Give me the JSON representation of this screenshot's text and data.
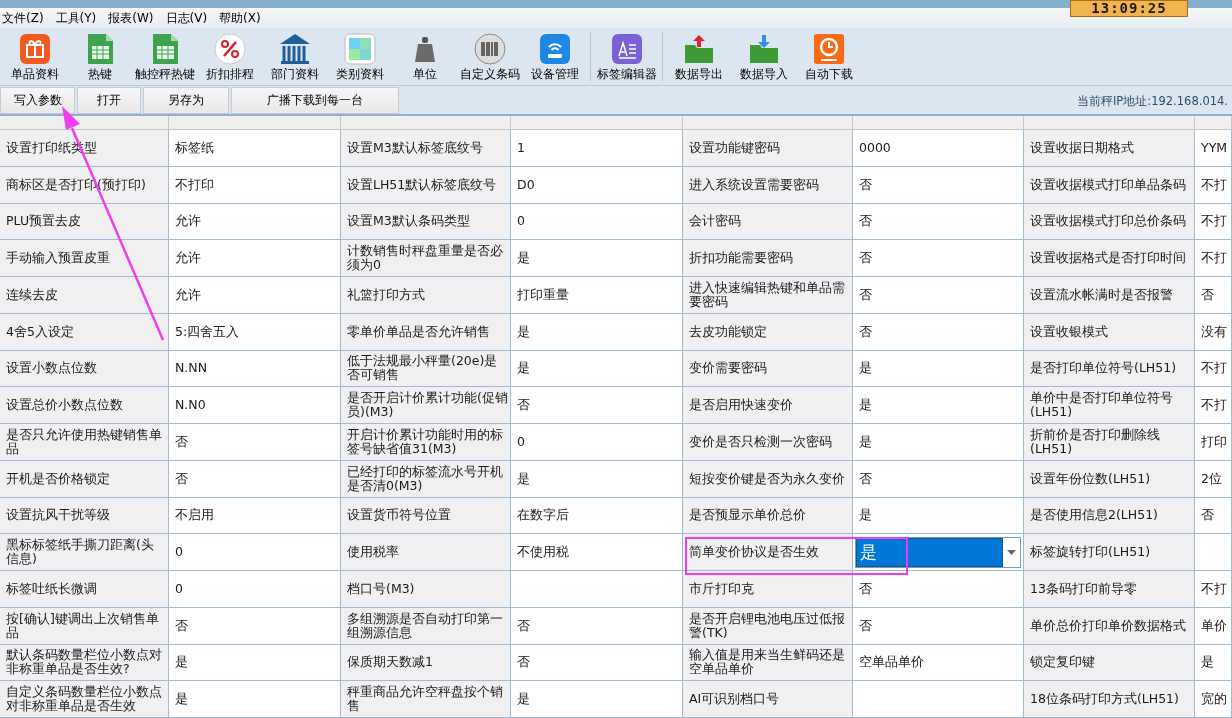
{
  "clock": "13:09:25",
  "menu": [
    "文件(Z)",
    "工具(Y)",
    "报表(W)",
    "日志(V)",
    "帮助(X)"
  ],
  "toolbar": {
    "groups": [
      [
        {
          "label": "单品资料",
          "kind": "gift"
        },
        {
          "label": "热键",
          "kind": "sheet"
        },
        {
          "label": "触控秤热键",
          "kind": "sheet"
        },
        {
          "label": "折扣排程",
          "kind": "discount"
        },
        {
          "label": "部门资料",
          "kind": "building"
        },
        {
          "label": "类别资料",
          "kind": "tiles"
        },
        {
          "label": "单位",
          "kind": "weight"
        },
        {
          "label": "自定义条码",
          "kind": "barcode"
        },
        {
          "label": "设备管理",
          "kind": "router"
        }
      ],
      [
        {
          "label": "标签编辑器",
          "kind": "label"
        }
      ],
      [
        {
          "label": "数据导出",
          "kind": "export"
        },
        {
          "label": "数据导入",
          "kind": "import"
        },
        {
          "label": "自动下载",
          "kind": "timer"
        }
      ]
    ]
  },
  "buttons": [
    "写入参数",
    "打开",
    "另存为",
    "广播下载到每一台"
  ],
  "ip_label": "当前秤IP地址:192.168.014.",
  "table": {
    "rows": [
      [
        "设置打印纸类型",
        "标签纸",
        "设置M3默认标签底纹号",
        "1",
        "设置功能键密码",
        "0000",
        "设置收据日期格式",
        "YYM"
      ],
      [
        "商标区是否打印(预打印)",
        "不打印",
        "设置LH51默认标签底纹号",
        "D0",
        "进入系统设置需要密码",
        "否",
        "设置收据模式打印单品条码",
        "不打"
      ],
      [
        "PLU预置去皮",
        "允许",
        "设置M3默认条码类型",
        "0",
        "会计密码",
        "否",
        "设置收据模式打印总价条码",
        "不打"
      ],
      [
        "手动输入预置皮重",
        "允许",
        "计数销售时秤盘重量是否必须为0",
        "是",
        "折扣功能需要密码",
        "否",
        "设置收据格式是否打印时间",
        "不打"
      ],
      [
        "连续去皮",
        "允许",
        "礼篮打印方式",
        "打印重量",
        "进入快速编辑热键和单品需要密码",
        "否",
        "设置流水帐满时是否报警",
        "否"
      ],
      [
        "4舍5入设定",
        "5:四舍五入",
        "零单价单品是否允许销售",
        "是",
        "去皮功能锁定",
        "否",
        "设置收银模式",
        "没有"
      ],
      [
        "设置小数点位数",
        "N.NN",
        "低于法规最小秤量(20e)是否可销售",
        "是",
        "变价需要密码",
        "是",
        "是否打印单位符号(LH51)",
        "不打"
      ],
      [
        "设置总价小数点位数",
        "N.N0",
        "是否开启计价累计功能(促销员)(M3)",
        "否",
        "是否启用快速变价",
        "是",
        "单价中是否打印单位符号(LH51)",
        "不打"
      ],
      [
        "是否只允许使用热键销售单品",
        "否",
        "开启计价累计功能时用的标签号缺省值31(M3)",
        "0",
        "变价是否只检测一次密码",
        "是",
        "折前价是否打印删除线(LH51)",
        "打印"
      ],
      [
        "开机是否价格锁定",
        "否",
        "已经打印的标签流水号开机是否清0(M3)",
        "是",
        "短按变价键是否为永久变价",
        "否",
        "设置年份位数(LH51)",
        "2位"
      ],
      [
        "设置抗风干扰等级",
        "不启用",
        "设置货币符号位置",
        "在数字后",
        "是否预显示单价总价",
        "是",
        "是否使用信息2(LH51)",
        "否"
      ],
      [
        "黑标标签纸手撕刀距离(头信息)",
        "0",
        "使用税率",
        "不使用税",
        "简单变价协议是否生效",
        {
          "kind": "dropdown",
          "value": "是",
          "selected": true
        },
        "标签旋转打印(LH51)",
        null
      ],
      [
        "标签吐纸长微调",
        "0",
        "档口号(M3)",
        null,
        "市斤打印克",
        "否",
        "13条码打印前导零",
        "不打"
      ],
      [
        "按[确认]键调出上次销售单品",
        "否",
        "多组溯源是否自动打印第一组溯源信息",
        "否",
        "是否开启锂电池电压过低报警(TK)",
        "否",
        "单价总价打印单价数据格式",
        "单价"
      ],
      [
        "默认条码数量栏位小数点对非称重单品是否生效?",
        "是",
        "保质期天数减1",
        "否",
        "输入值是用来当生鲜码还是空单品单价",
        "空单品单价",
        "锁定复印键",
        "是"
      ],
      [
        "自定义条码数量栏位小数点对非称重单品是否生效",
        "是",
        "秤重商品允许空秤盘按个销售",
        "是",
        "AI可识别档口号",
        null,
        "18位条码打印方式(LH51)",
        "宽的"
      ]
    ]
  }
}
